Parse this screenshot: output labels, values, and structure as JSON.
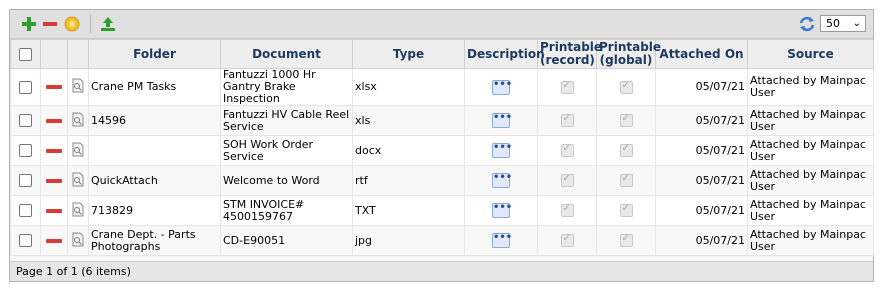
{
  "toolbar": {
    "add_icon": "plus-icon",
    "remove_icon": "minus-icon",
    "settings_icon": "gear-icon",
    "upload_icon": "upload-icon",
    "refresh_icon": "refresh-icon",
    "page_size": "50"
  },
  "columns": {
    "folder": "Folder",
    "document": "Document",
    "type": "Type",
    "description": "Description",
    "printable_record": "Printable (record)",
    "printable_global": "Printable (global)",
    "attached_on": "Attached On",
    "source": "Source"
  },
  "rows": [
    {
      "folder": "Crane PM Tasks",
      "document": "Fantuzzi 1000 Hr Gantry Brake Inspection",
      "type": "xlsx",
      "attached_on": "05/07/21",
      "source": "Attached by Mainpac User"
    },
    {
      "folder": "14596",
      "document": "Fantuzzi HV Cable Reel Service",
      "type": "xls",
      "attached_on": "05/07/21",
      "source": "Attached by Mainpac User"
    },
    {
      "folder": "",
      "document": "SOH Work Order Service",
      "type": "docx",
      "attached_on": "05/07/21",
      "source": "Attached by Mainpac User"
    },
    {
      "folder": "QuickAttach",
      "document": "Welcome to Word",
      "type": "rtf",
      "attached_on": "05/07/21",
      "source": "Attached by Mainpac User"
    },
    {
      "folder": "713829",
      "document": "STM INVOICE# 4500159767",
      "type": "TXT",
      "attached_on": "05/07/21",
      "source": "Attached by Mainpac User"
    },
    {
      "folder": "Crane Dept. - Parts Photographs",
      "document": "CD-E90051",
      "type": "jpg",
      "attached_on": "05/07/21",
      "source": "Attached by Mainpac User"
    }
  ],
  "footer": {
    "pager_text": "Page 1 of 1 (6 items)"
  },
  "colors": {
    "add": "#2e9e2e",
    "remove": "#d83a3a",
    "header_text": "#1f3a5f"
  }
}
